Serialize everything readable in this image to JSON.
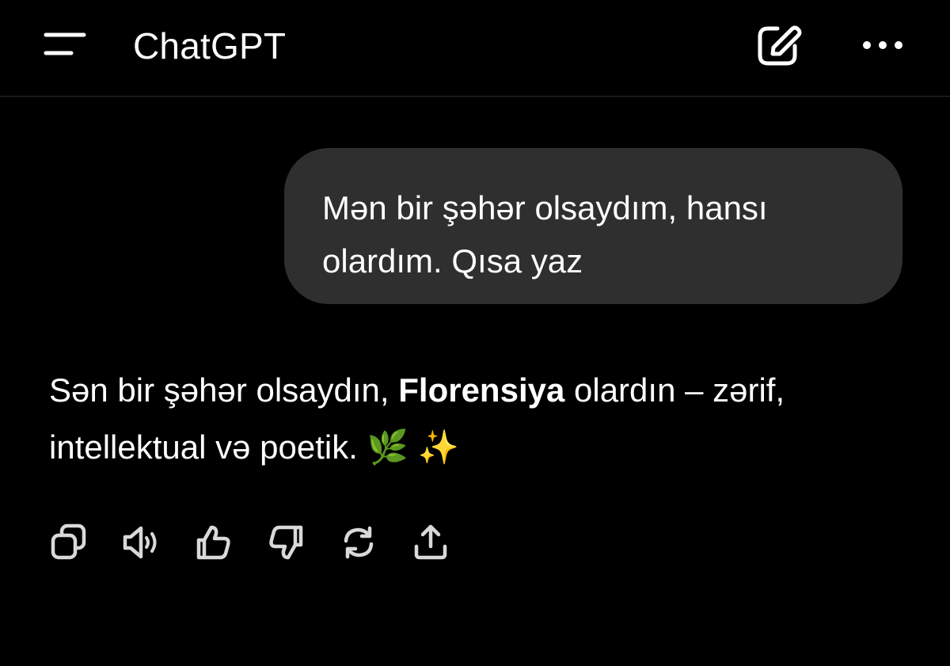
{
  "header": {
    "title": "ChatGPT",
    "menu_icon": "sidebar-menu-icon",
    "new_chat_icon": "compose-icon",
    "more_icon": "more-dots-icon"
  },
  "conversation": {
    "user_message": "Mən bir şəhər olsaydım, hansı olardım. Qısa yaz",
    "assistant_message": {
      "prefix": "Sən bir şəhər olsaydın, ",
      "bold": "Florensiya",
      "suffix": " olardın – zərif, intellektual və poetik. ",
      "emoji_1": "🌿",
      "emoji_2": "✨"
    }
  },
  "actions": [
    {
      "name": "copy",
      "icon": "copy-icon"
    },
    {
      "name": "read-aloud",
      "icon": "speaker-icon"
    },
    {
      "name": "good-response",
      "icon": "thumbs-up-icon"
    },
    {
      "name": "bad-response",
      "icon": "thumbs-down-icon"
    },
    {
      "name": "regenerate",
      "icon": "refresh-icon"
    },
    {
      "name": "share",
      "icon": "share-icon"
    }
  ],
  "colors": {
    "background": "#000000",
    "bubble": "#2f2f2f",
    "text": "#ffffff",
    "icon": "#d9d9d9",
    "divider": "#2a2a2a"
  }
}
